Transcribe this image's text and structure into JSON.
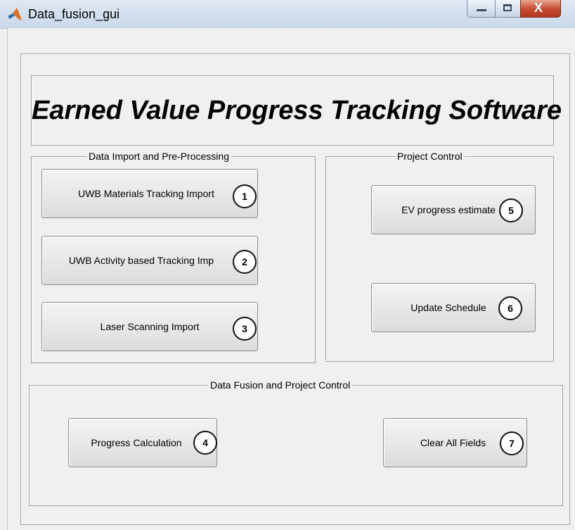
{
  "window": {
    "title": "Data_fusion_gui",
    "controls": {
      "minimize": "—",
      "maximize": "□",
      "close": "X"
    }
  },
  "header": {
    "app_title": "Earned Value Progress Tracking Software"
  },
  "panels": {
    "import": {
      "title": "Data Import and Pre-Processing",
      "buttons": [
        {
          "label": "UWB Materials Tracking Import",
          "callout": "1"
        },
        {
          "label": "UWB Activity based Tracking Imp",
          "callout": "2"
        },
        {
          "label": "Laser Scanning Import",
          "callout": "3"
        }
      ]
    },
    "control": {
      "title": "Project Control",
      "buttons": [
        {
          "label": "EV progress estimate",
          "callout": "5"
        },
        {
          "label": "Update Schedule",
          "callout": "6"
        }
      ]
    },
    "fusion": {
      "title": "Data Fusion and Project Control",
      "buttons": [
        {
          "label": "Progress Calculation",
          "callout": "4"
        },
        {
          "label": "Clear All Fields",
          "callout": "7"
        }
      ]
    }
  },
  "icons": {
    "app": "matlab-icon"
  },
  "colors": {
    "background": "#f0f0f0",
    "close_button": "#c5492f",
    "titlebar": "#d4e0ee"
  }
}
